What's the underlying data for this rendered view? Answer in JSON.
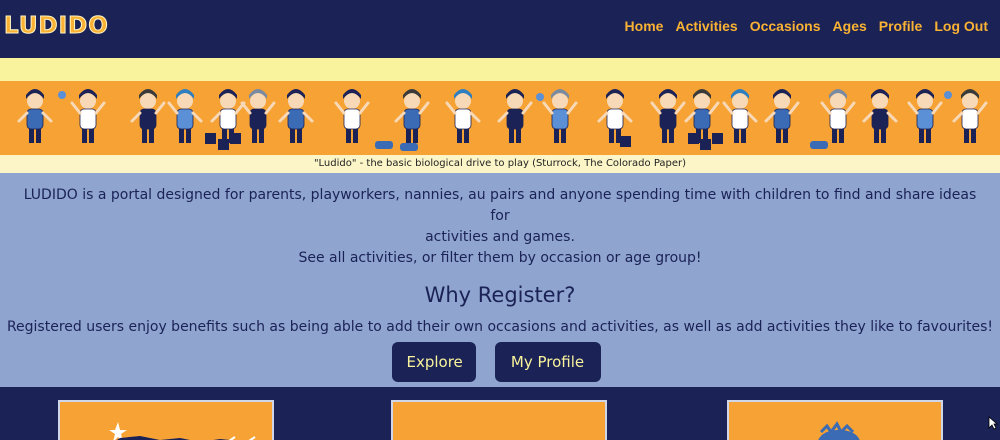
{
  "nav": {
    "logo": "LUDIDO",
    "links": [
      "Home",
      "Activities",
      "Occasions",
      "Ages",
      "Profile",
      "Log Out"
    ]
  },
  "banner": {
    "caption": "\"Ludido\" - the basic biological drive to play (Sturrock, The Colorado Paper)"
  },
  "intro": {
    "line1": "LUDIDO is a portal designed for parents, playworkers, nannies, au pairs and anyone spending time with children to find and share ideas for",
    "line2": "activities and games.",
    "line3": "See all activities, or filter them by occasion or age group!"
  },
  "register": {
    "heading": "Why Register?",
    "text": "Registered users enjoy benefits such as being able to add their own occasions and activities, as well as add activities they like to favourites!"
  },
  "buttons": {
    "explore": "Explore",
    "profile": "My Profile"
  },
  "colors": {
    "navy": "#1b2256",
    "orange": "#f6a234",
    "accent": "#f9b233",
    "cream": "#f8f39c",
    "main_bg": "#8fa4cf"
  }
}
